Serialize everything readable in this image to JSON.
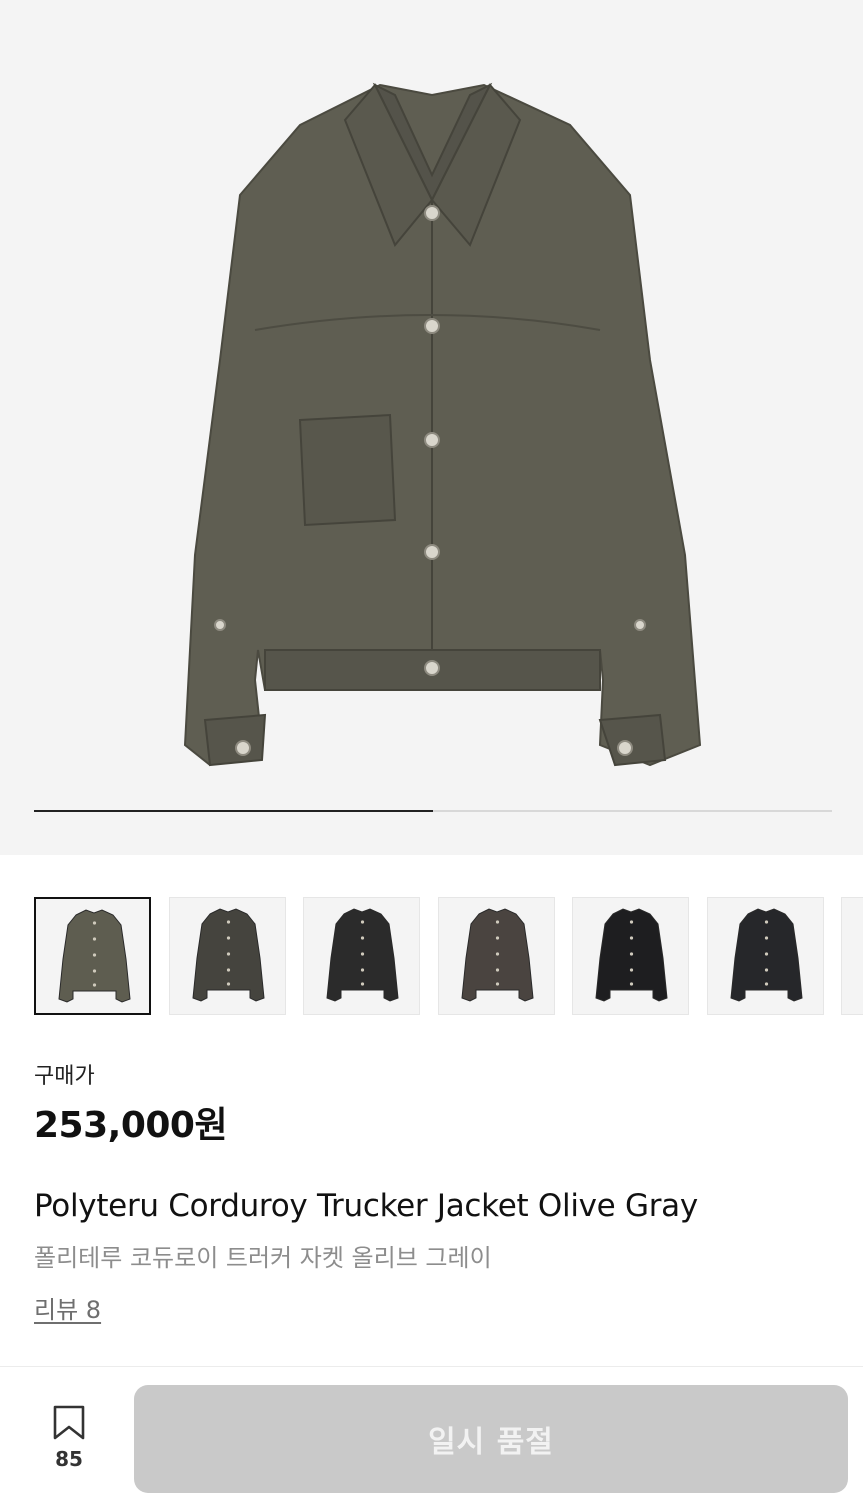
{
  "gallery": {
    "current_index": 1,
    "total": 2,
    "progress_fraction": 0.5,
    "main_color": "#5f5e52",
    "thumbnails": [
      {
        "name": "thumb-olive-gray",
        "color": "#5e5d50",
        "active": true
      },
      {
        "name": "thumb-charcoal",
        "color": "#45443e",
        "active": false
      },
      {
        "name": "thumb-black",
        "color": "#2b2b2b",
        "active": false
      },
      {
        "name": "thumb-brown-gray",
        "color": "#4a4440",
        "active": false
      },
      {
        "name": "thumb-black-speckle",
        "color": "#1e1e20",
        "active": false
      },
      {
        "name": "thumb-black-washed",
        "color": "#26272a",
        "active": false
      },
      {
        "name": "thumb-partial",
        "color": "#3a3a3a",
        "active": false
      }
    ]
  },
  "product": {
    "price_label": "구매가",
    "price": "253,000원",
    "title_en": "Polyteru Corduroy Trucker Jacket Olive Gray",
    "title_ko": "폴리테루 코듀로이 트러커 자켓 올리브 그레이",
    "review_link": "리뷰 8"
  },
  "bottom_bar": {
    "bookmark_icon": "bookmark-icon",
    "bookmark_count": "85",
    "action_label": "일시 품절",
    "action_color": "#c9c9c9"
  }
}
